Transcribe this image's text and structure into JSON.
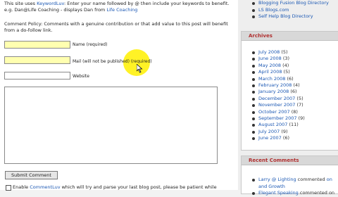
{
  "intro": {
    "t1": "This site uses ",
    "kw_link": "KeywordLuv",
    "t2": ": Enter your name followed by @ then include your keywords to benefit. e.g. Dan@Life Coaching - displays Dan from ",
    "lc_link": "Life Coaching"
  },
  "policy": "Comment Policy: Comments with a genuine contribution or that add value to this post will benefit from a do-follow link.",
  "form": {
    "name_label": "Name (required)",
    "mail_label": "Mail (will not be published) (required)",
    "website_label": "Website",
    "submit_label": "Submit Comment",
    "enable_t1": "Enable ",
    "enable_link": "CommentLuv",
    "enable_t2": " which will try and parse your last blog post, please be patient while"
  },
  "top_links": [
    "Blogging Fusion Blog Directory",
    "LS Blogs.com",
    "Self Help Blog Directory"
  ],
  "archives": {
    "title": "Archives",
    "items": [
      {
        "month": "July 2008",
        "count": "(5)"
      },
      {
        "month": "June 2008",
        "count": "(3)"
      },
      {
        "month": "May 2008",
        "count": "(4)"
      },
      {
        "month": "April 2008",
        "count": "(5)"
      },
      {
        "month": "March 2008",
        "count": "(6)"
      },
      {
        "month": "February 2008",
        "count": "(4)"
      },
      {
        "month": "January 2008",
        "count": "(6)"
      },
      {
        "month": "December 2007",
        "count": "(5)"
      },
      {
        "month": "November 2007",
        "count": "(7)"
      },
      {
        "month": "October 2007",
        "count": "(8)"
      },
      {
        "month": "September 2007",
        "count": "(9)"
      },
      {
        "month": "August 2007",
        "count": "(11)"
      },
      {
        "month": "July 2007",
        "count": "(9)"
      },
      {
        "month": "June 2007",
        "count": "(6)"
      }
    ]
  },
  "recent": {
    "title": "Recent Comments",
    "c1_author": "Larry @ Lighting",
    "c1_mid": " commented ",
    "c1_on": "on",
    "c1_post": "and Growth",
    "c2_author": "Elegant Speaking",
    "c2_mid": " commented on"
  },
  "colors": {
    "link": "#1a57b3",
    "box_title": "#b03030",
    "highlight": "#fff000",
    "input_fill": "#ffffb0"
  }
}
